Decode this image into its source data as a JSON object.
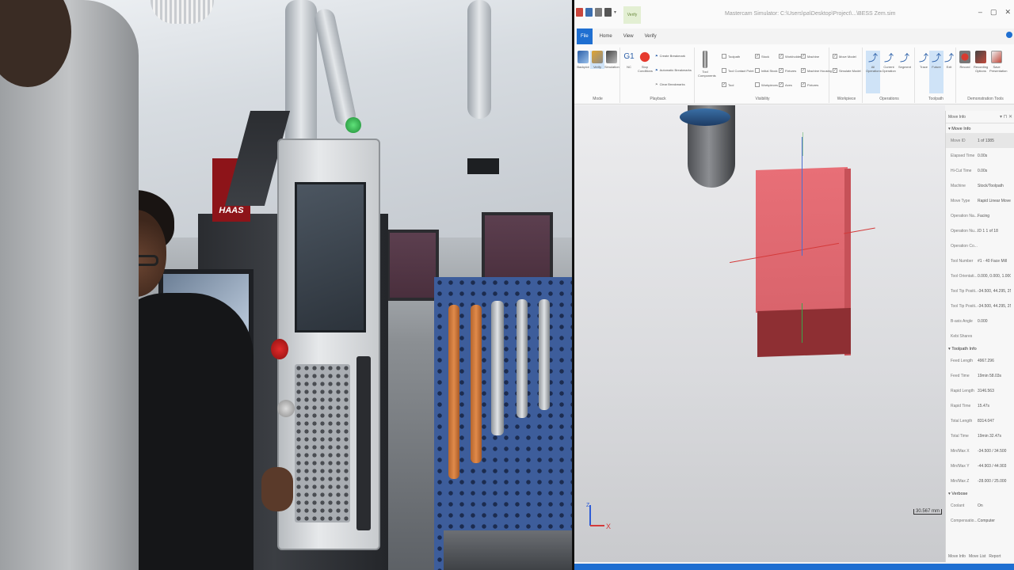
{
  "app": {
    "window_title": "Mastercam Simulator: C:\\Users\\pa\\Desktop\\Project\\...\\BESS Zem.sim",
    "contextual_tab": "Verify",
    "window_controls": [
      "–",
      "▢",
      "✕"
    ],
    "tabs": [
      "File",
      "Home",
      "View",
      "Verify"
    ],
    "ribbon_groups": {
      "mode": {
        "label": "Mode",
        "buttons": [
          "Backplot",
          "Verify",
          "Simulation"
        ]
      },
      "playback": {
        "label": "Playback",
        "buttons": [
          "NC",
          "Stop Conditions",
          "Create Breakmark",
          "Automatic Breakmarks",
          "Clear Breakmarks"
        ]
      },
      "visibility": {
        "label": "Visibility",
        "buttons": [
          "Tool Components",
          "Toolpath",
          "Tool Contact Point",
          "Tool",
          "Stock",
          "Initial Stock",
          "Workpieces",
          "Workholder",
          "Fixtures",
          "Axes",
          "Machine",
          "Machine Housing",
          "Fixtures"
        ]
      },
      "workpiece": {
        "label": "Workpiece",
        "buttons": [
          "Move Model",
          "Simulate Model"
        ]
      },
      "operations": {
        "label": "Operations",
        "buttons": [
          "All Operations",
          "Current Operation",
          "Segment"
        ]
      },
      "toolpath": {
        "label": "Toolpath",
        "buttons": [
          "Trace",
          "Future",
          "Exit"
        ]
      },
      "demonstration": {
        "label": "Demonstration Tools",
        "buttons": [
          "Record",
          "Recording Options",
          "Save Presentation"
        ]
      }
    },
    "viewport": {
      "scale_label": "30.567 mm",
      "axis_z": "Z",
      "axis_x": "X"
    },
    "side_panel": {
      "title": "Move Info",
      "sections": [
        {
          "title": "Move Info",
          "rows": [
            {
              "k": "Move ID",
              "v": "1 of 1385"
            },
            {
              "k": "Elapsed Time",
              "v": "0.00s"
            },
            {
              "k": "Hi-Cut Time",
              "v": "0.00s"
            },
            {
              "k": "Machine",
              "v": "Stock/Toolpath"
            },
            {
              "k": "Move Type",
              "v": "Rapid Linear Move"
            },
            {
              "k": "Operation Na...",
              "v": "Facing"
            },
            {
              "k": "Operation Nu...",
              "v": "ID 1 1 of 18"
            },
            {
              "k": "Operation Co...",
              "v": ""
            },
            {
              "k": "Tool Number",
              "v": "#1 - 40 Face Mill"
            },
            {
              "k": "Tool Orientati...",
              "v": "0.000, 0.000, 1.000"
            },
            {
              "k": "Tool Tip Positi...",
              "v": "-34.500, 44.295, 25"
            },
            {
              "k": "Tool Tip Positi...",
              "v": "-34.500, 44.295, 25"
            },
            {
              "k": "B-axis Angle",
              "v": "0.000"
            },
            {
              "k": "Kebi Shares",
              "v": ""
            }
          ]
        },
        {
          "title": "Toolpath Info",
          "rows": [
            {
              "k": "Feed Length",
              "v": "4967.296"
            },
            {
              "k": "Feed Time",
              "v": "19min 58.03s"
            },
            {
              "k": "Rapid Length",
              "v": "3146.563"
            },
            {
              "k": "Rapid Time",
              "v": "15.47s"
            },
            {
              "k": "Total Length",
              "v": "8314.047"
            },
            {
              "k": "Total Time",
              "v": "19min 32.47s"
            },
            {
              "k": "Min/Max X",
              "v": "-34.500 / 34.500"
            },
            {
              "k": "Min/Max Y",
              "v": "-44.903 / 44.903"
            },
            {
              "k": "Min/Max Z",
              "v": "-28.000 / 25.000"
            }
          ]
        },
        {
          "title": "Verbose",
          "rows": [
            {
              "k": "Coolant",
              "v": "On"
            },
            {
              "k": "Compensatio...",
              "v": "Computer"
            }
          ]
        }
      ],
      "footer_tabs": [
        "Move Info",
        "Move List",
        "Report"
      ]
    },
    "colors": {
      "accent": "#1f6fd1",
      "stock_top": "#e86f77",
      "stock_bottom": "#8e2f33"
    }
  },
  "camera": {
    "sign_text": "HAAS"
  }
}
